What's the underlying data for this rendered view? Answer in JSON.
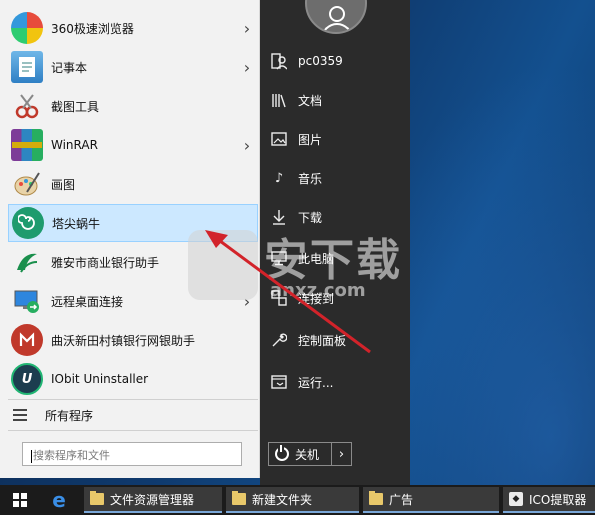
{
  "start_menu": {
    "apps": [
      {
        "label": "360极速浏览器",
        "icon": "360-browser-icon",
        "has_submenu": true
      },
      {
        "label": "记事本",
        "icon": "notepad-icon",
        "has_submenu": true
      },
      {
        "label": "截图工具",
        "icon": "snipping-tool-icon",
        "has_submenu": false
      },
      {
        "label": "WinRAR",
        "icon": "winrar-icon",
        "has_submenu": true
      },
      {
        "label": "画图",
        "icon": "paint-icon",
        "has_submenu": false
      },
      {
        "label": "塔尖蜗牛",
        "icon": "snail-icon",
        "has_submenu": false,
        "selected": true
      },
      {
        "label": "雅安市商业银行助手",
        "icon": "bank-helper-icon",
        "has_submenu": false
      },
      {
        "label": "远程桌面连接",
        "icon": "remote-desktop-icon",
        "has_submenu": true
      },
      {
        "label": "曲沃新田村镇银行网银助手",
        "icon": "village-bank-icon",
        "has_submenu": false
      },
      {
        "label": "IObit Uninstaller",
        "icon": "iobit-uninstaller-icon",
        "has_submenu": false
      }
    ],
    "all_programs": "所有程序",
    "search_placeholder": "搜索程序和文件",
    "right_items": [
      {
        "label": "pc0359",
        "icon": "user-folder-icon"
      },
      {
        "label": "文档",
        "icon": "documents-icon"
      },
      {
        "label": "图片",
        "icon": "pictures-icon"
      },
      {
        "label": "音乐",
        "icon": "music-icon"
      },
      {
        "label": "下载",
        "icon": "download-icon"
      },
      {
        "label": "此电脑",
        "icon": "computer-icon"
      },
      {
        "label": "连接到",
        "icon": "connect-icon"
      },
      {
        "label": "控制面板",
        "icon": "control-panel-icon"
      },
      {
        "label": "运行...",
        "icon": "run-icon"
      }
    ],
    "power_label": "关机",
    "power_more": "›"
  },
  "watermark": {
    "main": "安下载",
    "sub": "anxz.com"
  },
  "taskbar": {
    "items": [
      {
        "label": "文件资源管理器",
        "icon": "folder-icon"
      },
      {
        "label": "新建文件夹",
        "icon": "folder-icon"
      },
      {
        "label": "广告",
        "icon": "folder-icon"
      },
      {
        "label": "ICO提取器",
        "icon": "ico-extractor-icon"
      }
    ]
  },
  "colors": {
    "menu_bg": "#f2f2f2",
    "right_panel_bg": "#2b2b2b",
    "selection": "#cce8ff",
    "taskbar_bg": "#1b1b1b",
    "arrow": "#d2232a"
  }
}
